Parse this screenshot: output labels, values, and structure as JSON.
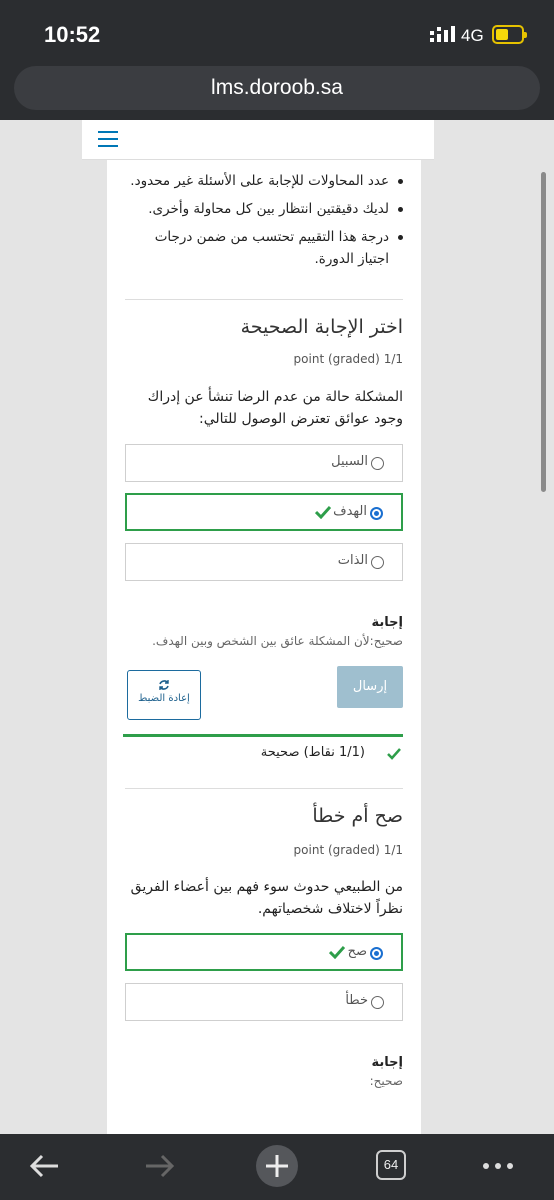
{
  "status": {
    "time": "10:52",
    "network": "4G"
  },
  "browser": {
    "url": "lms.doroob.sa",
    "tabs_count": "64"
  },
  "rules": [
    "عدد المحاولات للإجابة على الأسئلة غير محدود.",
    "لديك دقيقتين انتظار بين كل محاولة وأخرى.",
    "درجة هذا التقييم تحتسب من ضمن درجات اجتياز الدورة."
  ],
  "q1": {
    "title": "اختر الإجابة الصحيحة",
    "points": "1/1 point (graded)",
    "text": "المشكلة حالة من عدم الرضا تنشأ عن إدراك وجود عوائق تعترض الوصول للتالي:",
    "options": [
      "السبيل",
      "الهدف",
      "الذات"
    ],
    "selected": "الهدف",
    "answer_title": "إجابة",
    "answer_text": "صحيح:لأن المشكلة عائق بين الشخص وبين الهدف.",
    "submit_label": "إرسال",
    "reset_label": "إعادة الضبط",
    "result": "(1/1 نقاط) صحيحة"
  },
  "q2": {
    "title": "صح أم خطأ",
    "points": "1/1 point (graded)",
    "text": "من الطبيعي حدوث سوء فهم بين أعضاء الفريق نظراً لاختلاف شخصياتهم.",
    "options": [
      "صح",
      "خطأ"
    ],
    "selected": "صح",
    "answer_title": "إجابة",
    "answer_text": "صحيح:"
  },
  "colors": {
    "correct": "#2e9e4a",
    "accent": "#1a6fd0",
    "submit_disabled": "#9fbfcf"
  }
}
